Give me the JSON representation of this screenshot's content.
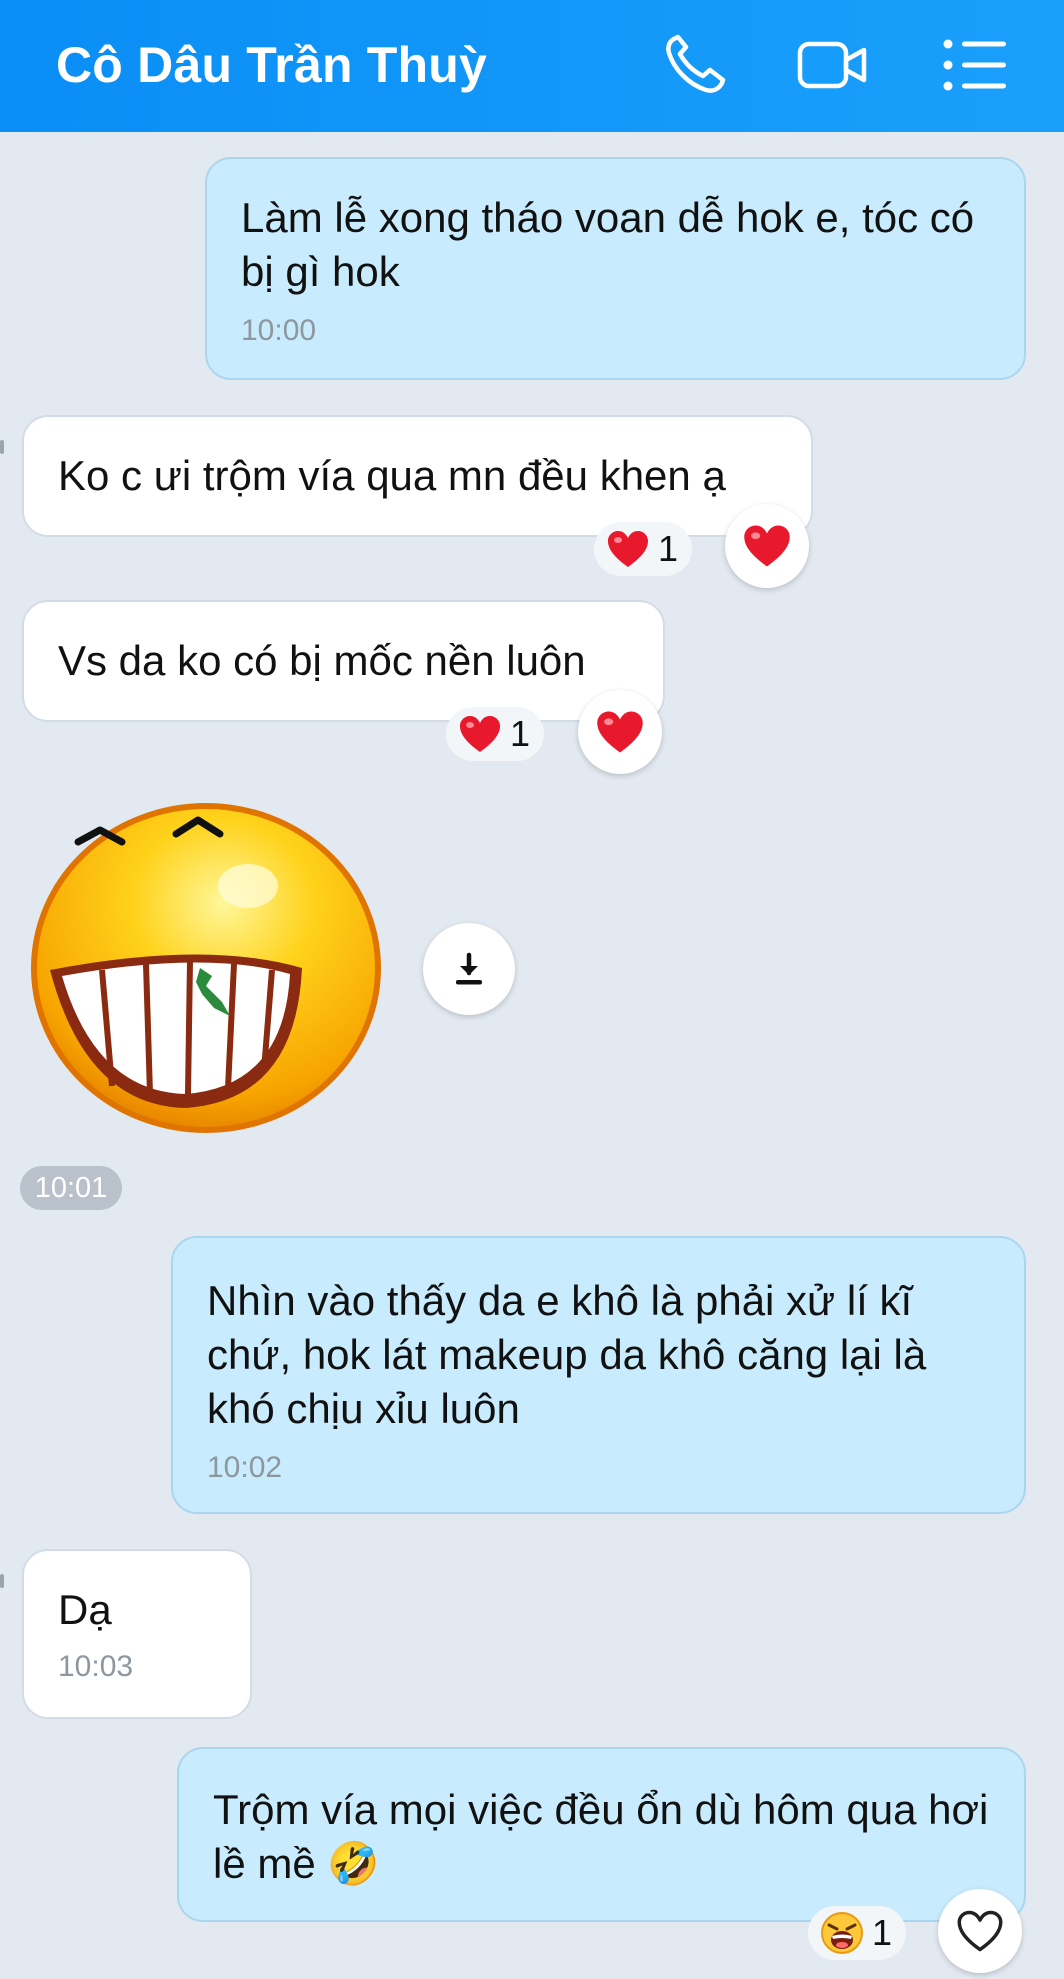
{
  "header": {
    "title": "Cô Dâu Trần Thuỳ",
    "icons": [
      "phone-icon",
      "video-camera-icon",
      "menu-list-icon"
    ],
    "color": "#1298f8"
  },
  "messages": [
    {
      "side": "out",
      "text": "Làm lễ xong tháo voan dễ hok e, tóc có bị gì hok",
      "time": "10:00"
    },
    {
      "side": "in",
      "text": "Ko c ưi trộm vía qua mn đều khen ạ",
      "reaction": {
        "emoji": "heart",
        "count": "1"
      }
    },
    {
      "side": "in",
      "text": "Vs da ko có bị mốc nền luôn",
      "reaction": {
        "emoji": "heart",
        "count": "1"
      }
    },
    {
      "side": "in",
      "type": "sticker",
      "sticker": "grinning-emoticon-with-leaf-in-teeth",
      "time": "10:01"
    },
    {
      "side": "out",
      "text": "Nhìn vào thấy da e khô là phải xử lí kĩ chứ, hok lát makeup da khô căng lại là khó chịu xỉu luôn",
      "time": "10:02"
    },
    {
      "side": "in",
      "text": "Dạ",
      "time": "10:03"
    },
    {
      "side": "out",
      "text": "Trộm vía mọi việc đều ổn dù hôm qua hơi lề mề 🤣",
      "reaction": {
        "emoji": "laughing-face",
        "count": "1"
      }
    }
  ],
  "colors": {
    "outgoing_bubble": "#c8ecfd",
    "incoming_bubble": "#ffffff",
    "background": "#e2e9f1",
    "heart": "#e8192c"
  }
}
